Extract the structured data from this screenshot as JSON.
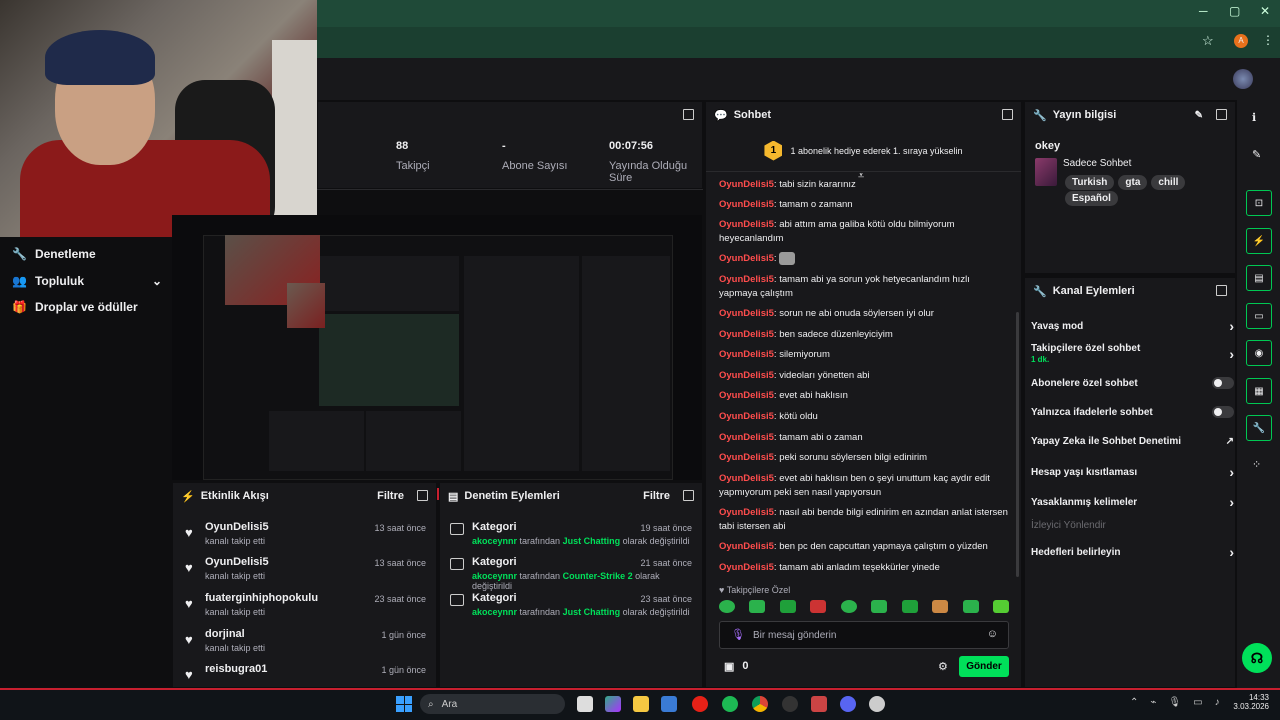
{
  "stats": [
    {
      "value": "88",
      "label": "Takipçi"
    },
    {
      "value": "-",
      "label": "Abone Sayısı"
    },
    {
      "value": "00:07:56",
      "label": "Yayında Olduğu Süre"
    }
  ],
  "left_nav": [
    {
      "label": "Denetleme",
      "icon": "wrench-icon"
    },
    {
      "label": "Topluluk",
      "icon": "users-icon"
    },
    {
      "label": "Droplar ve ödüller",
      "icon": "gift-icon"
    }
  ],
  "activity": {
    "title": "Etkinlik Akışı",
    "filter": "Filtre",
    "items": [
      {
        "name": "OyunDelisi5",
        "sub": "kanalı takip etti",
        "time": "13 saat önce"
      },
      {
        "name": "OyunDelisi5",
        "sub": "kanalı takip etti",
        "time": "13 saat önce"
      },
      {
        "name": "fuaterginhiphopokulu",
        "sub": "kanalı takip etti",
        "time": "23 saat önce"
      },
      {
        "name": "dorjinal",
        "sub": "kanalı takip etti",
        "time": "1 gün önce"
      },
      {
        "name": "reisbugra01",
        "sub": "",
        "time": "1 gün önce"
      }
    ]
  },
  "moderation": {
    "title": "Denetim Eylemleri",
    "filter": "Filtre",
    "items": [
      {
        "name": "Kategori",
        "by": "akoceynnr",
        "mid": " tarafından ",
        "cat": "Just Chatting",
        "end": " olarak değiştirildi",
        "time": "19 saat önce"
      },
      {
        "name": "Kategori",
        "by": "akoceynnr",
        "mid": " tarafından ",
        "cat": "Counter-Strike 2",
        "end": " olarak değiştirildi",
        "time": "21 saat önce"
      },
      {
        "name": "Kategori",
        "by": "akoceynnr",
        "mid": " tarafından ",
        "cat": "Just Chatting",
        "end": " olarak değiştirildi",
        "time": "23 saat önce"
      }
    ]
  },
  "chat": {
    "title": "Sohbet",
    "gift_badge": "1",
    "gift_text": "1 abonelik hediye ederek 1. sıraya yükselin",
    "messages": [
      {
        "user": "OyunDelisi5",
        "text": ": tabi sizin kararınız"
      },
      {
        "user": "OyunDelisi5",
        "text": ": tamam o zamann"
      },
      {
        "user": "OyunDelisi5",
        "text": ": abi attım ama galiba kötü oldu bilmiyorum heyecanlandım"
      },
      {
        "user": "OyunDelisi5",
        "text": ": "
      },
      {
        "user": "OyunDelisi5",
        "text": ": tamam abi ya sorun yok hetyecanlandım hızlı yapmaya çalıştım"
      },
      {
        "user": "OyunDelisi5",
        "text": ": sorun ne abi onuda söylersen iyi olur"
      },
      {
        "user": "OyunDelisi5",
        "text": ": ben sadece düzenleyiciyim"
      },
      {
        "user": "OyunDelisi5",
        "text": ": silemiyorum"
      },
      {
        "user": "OyunDelisi5",
        "text": ": videoları yönetten abi"
      },
      {
        "user": "OyunDelisi5",
        "text": ": evet abi haklısın"
      },
      {
        "user": "OyunDelisi5",
        "text": ": kötü oldu"
      },
      {
        "user": "OyunDelisi5",
        "text": ": tamam abi o zaman"
      },
      {
        "user": "OyunDelisi5",
        "text": ": peki sorunu söylersen bilgi edinirim"
      },
      {
        "user": "OyunDelisi5",
        "text": ": evet abi haklısın ben o şeyi unuttum kaç aydır edit yapmıyorum peki sen nasıl yapıyorsun"
      },
      {
        "user": "OyunDelisi5",
        "text": ": nasıl abi bende bilgi edinirim en azından anlat istersen tabi istersen abi"
      },
      {
        "user": "OyunDelisi5",
        "text": ": ben pc den capcuttan yapmaya çalıştım o yüzden"
      },
      {
        "user": "OyunDelisi5",
        "text": ": tamam abi anladım teşekkürler yinede"
      }
    ],
    "followers_only": "Takipçilere Özel",
    "placeholder": "Bir mesaj gönderin",
    "points": "0",
    "send": "Gönder"
  },
  "stream_info": {
    "title": "Yayın bilgisi",
    "stream_title": "okey",
    "category": "Sadece Sohbet",
    "tags": [
      "Turkish",
      "gta",
      "chill",
      "Español"
    ]
  },
  "channel_actions": {
    "title": "Kanal Eylemleri",
    "items": [
      {
        "label": "Yavaş mod",
        "type": "chevron",
        "sub": ""
      },
      {
        "label": "Takipçilere özel sohbet",
        "type": "chevron",
        "sub": "1 dk."
      },
      {
        "label": "Abonelere özel sohbet",
        "type": "toggle",
        "sub": ""
      },
      {
        "label": "Yalnızca ifadelerle sohbet",
        "type": "toggle",
        "sub": ""
      },
      {
        "label": "Yapay Zeka ile Sohbet Denetimi",
        "type": "external",
        "sub": ""
      },
      {
        "label": "Hesap yaşı kısıtlaması",
        "type": "chevron",
        "sub": ""
      },
      {
        "label": "Yasaklanmış kelimeler",
        "type": "chevron",
        "sub": ""
      },
      {
        "label": "İzleyici Yönlendir",
        "type": "disabled",
        "sub": ""
      },
      {
        "label": "Hedefleri belirleyin",
        "type": "chevron",
        "sub": ""
      }
    ]
  },
  "taskbar": {
    "search": "Ara",
    "time": "14:33",
    "date": "3.03.2026"
  },
  "colors": {
    "accent": "#00e05a",
    "username": "#ff4d4d",
    "panel": "#18181b",
    "bg": "#0e0e10"
  }
}
